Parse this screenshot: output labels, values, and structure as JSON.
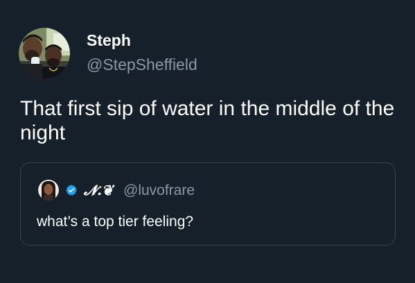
{
  "tweet": {
    "author": {
      "name": "Steph",
      "handle": "@StepSheffield",
      "avatar_icon": "profile-photo-two-men"
    },
    "text": "That first sip of water in the middle of the night",
    "quoted_tweet": {
      "author": {
        "display_name": "𝓝.❦",
        "handle": "@luvofrare",
        "avatar_icon": "profile-photo-woman",
        "verified": true,
        "verified_icon": "verified-badge-icon"
      },
      "text": "what’s a top tier feeling?"
    }
  },
  "colors": {
    "background": "#15202b",
    "primary_text": "#ffffff",
    "secondary_text": "#8899a6",
    "card_border": "#38444d",
    "verified_blue": "#1da1f2"
  }
}
